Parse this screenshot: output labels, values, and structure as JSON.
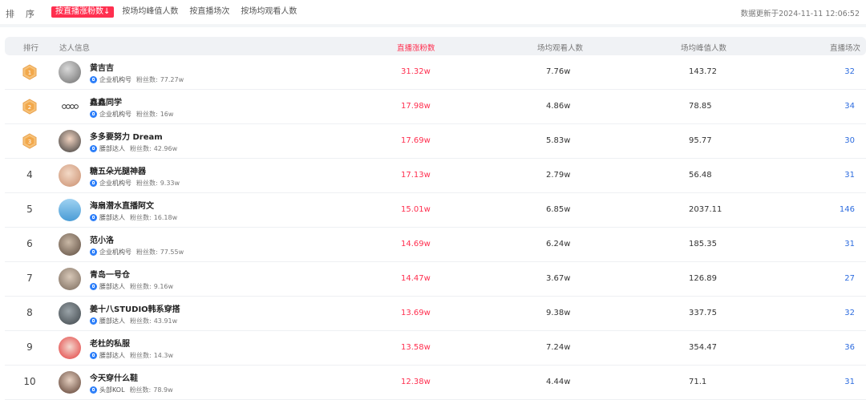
{
  "header": {
    "sort_title": "排序",
    "tabs": [
      {
        "label": "按直播涨粉数↓",
        "active": true
      },
      {
        "label": "按场均峰值人数",
        "active": false
      },
      {
        "label": "按直播场次",
        "active": false
      },
      {
        "label": "按场均观看人数",
        "active": false
      }
    ],
    "updated": "数据更新于2024-11-11 12:06:52"
  },
  "table": {
    "columns": [
      "排行",
      "达人信息",
      "直播涨粉数",
      "场均观看人数",
      "场均峰值人数",
      "直播场次"
    ],
    "fans_prefix": "粉丝数:",
    "rows": [
      {
        "rank": "1",
        "name": "黄吉吉",
        "type": "企业机构号",
        "fans": "77.27w",
        "gain": "31.32w",
        "avg": "7.76w",
        "peak": "143.72",
        "count": "32"
      },
      {
        "rank": "2",
        "name": "鑫鑫同学",
        "type": "企业机构号",
        "fans": "16w",
        "gain": "17.98w",
        "avg": "4.86w",
        "peak": "78.85",
        "count": "34"
      },
      {
        "rank": "3",
        "name": "多多要努力 Dream",
        "type": "腰部达人",
        "fans": "42.96w",
        "gain": "17.69w",
        "avg": "5.83w",
        "peak": "95.77",
        "count": "30"
      },
      {
        "rank": "4",
        "name": "糖五朵光腿神器",
        "type": "企业机构号",
        "fans": "9.33w",
        "gain": "17.13w",
        "avg": "2.79w",
        "peak": "56.48",
        "count": "31"
      },
      {
        "rank": "5",
        "name": "海扇潜水直播阿文",
        "type": "腰部达人",
        "fans": "16.18w",
        "gain": "15.01w",
        "avg": "6.85w",
        "peak": "2037.11",
        "count": "146"
      },
      {
        "rank": "6",
        "name": "范小洛",
        "type": "企业机构号",
        "fans": "77.55w",
        "gain": "14.69w",
        "avg": "6.24w",
        "peak": "185.35",
        "count": "31"
      },
      {
        "rank": "7",
        "name": "青岛一号仓",
        "type": "腰部达人",
        "fans": "9.16w",
        "gain": "14.47w",
        "avg": "3.67w",
        "peak": "126.89",
        "count": "27"
      },
      {
        "rank": "8",
        "name": "姜十八STUDIO韩系穿搭",
        "type": "腰部达人",
        "fans": "43.91w",
        "gain": "13.69w",
        "avg": "9.38w",
        "peak": "337.75",
        "count": "32"
      },
      {
        "rank": "9",
        "name": "老杜的私服",
        "type": "腰部达人",
        "fans": "14.3w",
        "gain": "13.58w",
        "avg": "7.24w",
        "peak": "354.47",
        "count": "36"
      },
      {
        "rank": "10",
        "name": "今天穿什么鞋",
        "type": "头部KOL",
        "fans": "78.9w",
        "gain": "12.38w",
        "avg": "4.44w",
        "peak": "71.1",
        "count": "31"
      }
    ]
  },
  "colors": {
    "accent": "#ff2f4f",
    "link": "#2d6cdf",
    "badge": "#2d7ff9",
    "medal": "#f2b15a"
  }
}
